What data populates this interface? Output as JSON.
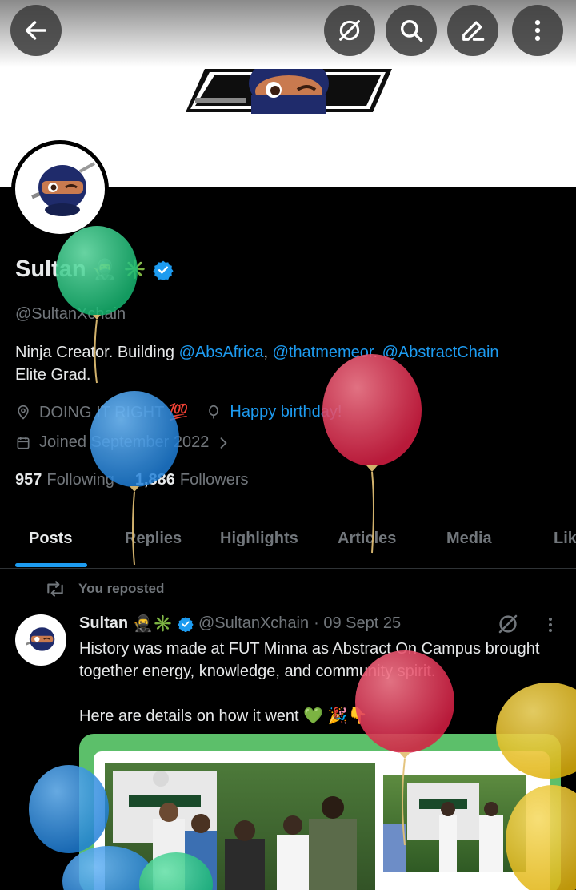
{
  "header": {
    "back_icon": "arrow-left-icon",
    "grok_icon": "grok-icon",
    "search_icon": "search-icon",
    "edit_icon": "pencil-icon",
    "more_icon": "more-vertical-icon"
  },
  "profile": {
    "display_name": "Sultan",
    "name_emoji_1": "🥷",
    "name_emoji_2": "✳️",
    "handle": "@SultanXchain",
    "bio_prefix": "Ninja Creator. Building ",
    "bio_link_1": "@AbsAfrica",
    "bio_sep_1": ", ",
    "bio_link_2": "@thatmemeor",
    "bio_sep_2": ". ",
    "bio_link_3": "@AbstractChain",
    "bio_line_2": "Elite Grad.",
    "location": "DOING IT RIGHT 💯",
    "website": "Happy birthday!",
    "joined": "Joined September 2022",
    "following_count": "957",
    "following_label": "Following",
    "followers_count": "1,886",
    "followers_label": "Followers",
    "verified_color": "#1d9bf0"
  },
  "tabs": [
    "Posts",
    "Replies",
    "Highlights",
    "Articles",
    "Media",
    "Lik"
  ],
  "post": {
    "repost_label": "You reposted",
    "author_name": "Sultan",
    "author_emoji": "🥷✳️",
    "author_handle": "@SultanXchain",
    "date": "· 09 Sept 25",
    "text_line_1": "History was made at FUT Minna as Abstract On Campus brought together energy, knowledge, and community spirit.",
    "text_line_2": "Here are details on how it went 💚 🎉👇"
  },
  "colors": {
    "accent": "#1d9bf0",
    "background": "#000000",
    "secondary_text": "#71767b",
    "media_frame": "#5cbf6a"
  }
}
